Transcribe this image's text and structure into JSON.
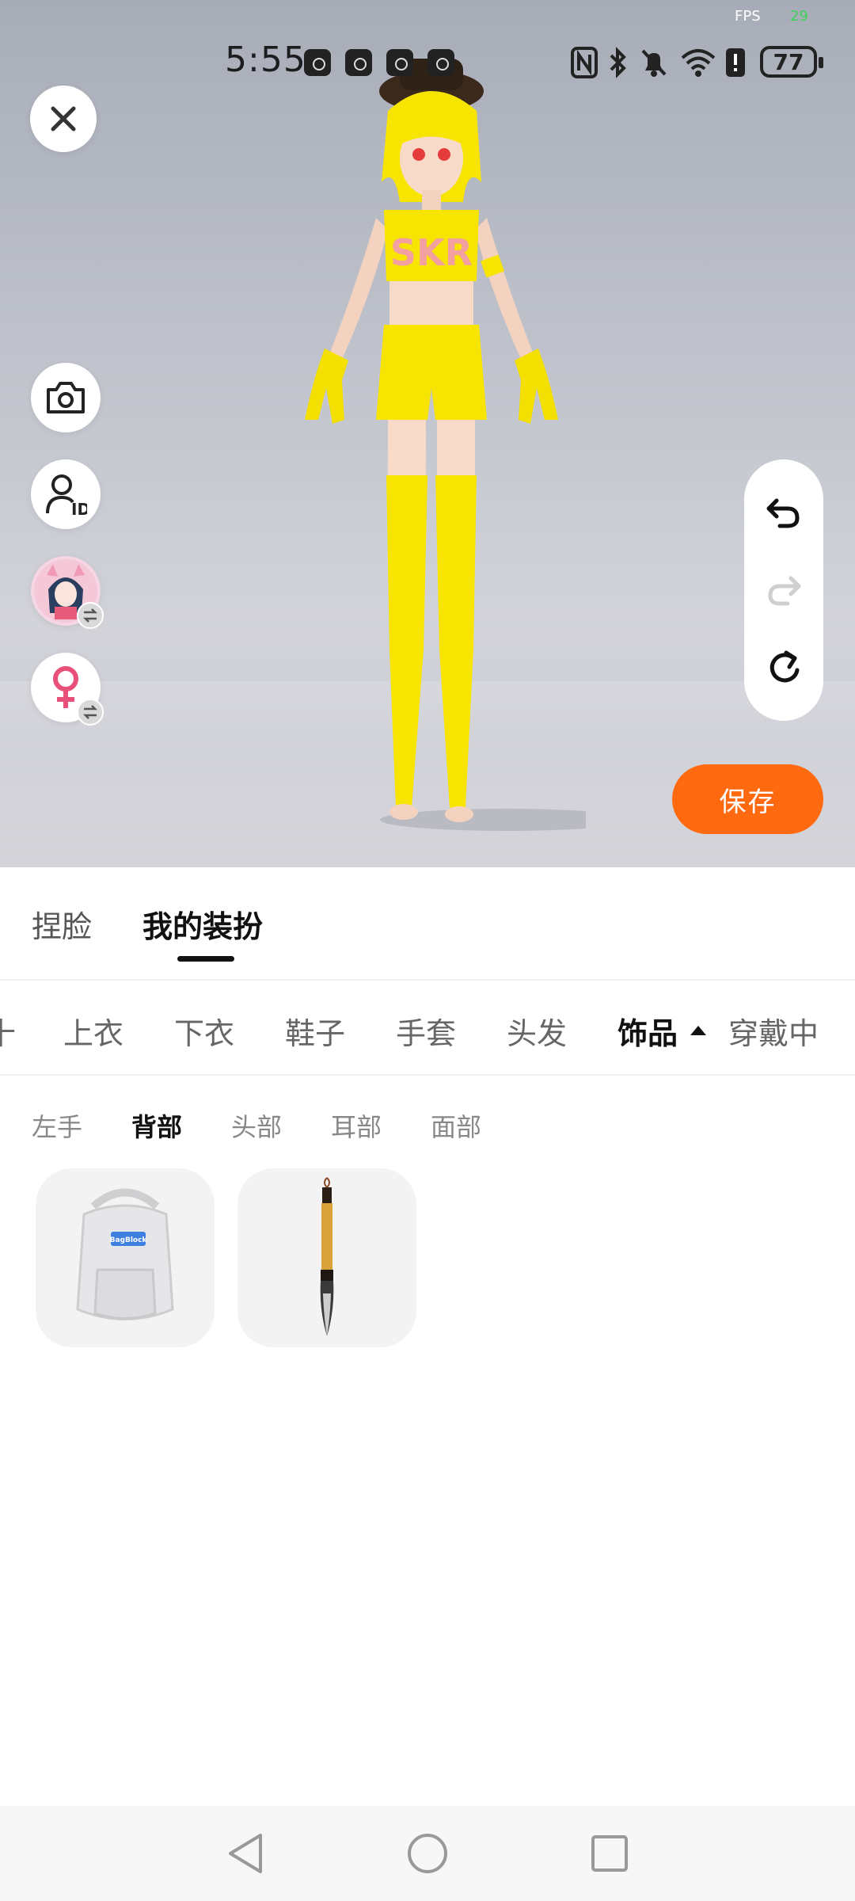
{
  "status_bar": {
    "time": "5:55",
    "fps_label": "FPS",
    "fps_value": "29",
    "battery": "77",
    "icons": [
      "nfc-icon",
      "bluetooth-icon",
      "mute-icon",
      "wifi-icon",
      "sim-alert-icon",
      "battery-icon"
    ]
  },
  "viewport": {
    "close_icon": "close-icon",
    "left_tools": [
      "camera-icon",
      "avatar-id-icon",
      "avatar-thumbnail",
      "female-icon"
    ],
    "history": [
      "undo-icon",
      "redo-icon",
      "reset-icon"
    ],
    "save_label": "保存",
    "accent": "#ff6a10",
    "chest_logo": "SKR"
  },
  "main_tabs": [
    {
      "label": "捏脸",
      "active": false
    },
    {
      "label": "我的装扮",
      "active": true
    }
  ],
  "category_tabs": [
    {
      "label": "十"
    },
    {
      "label": "上衣"
    },
    {
      "label": "下衣"
    },
    {
      "label": "鞋子"
    },
    {
      "label": "手套"
    },
    {
      "label": "头发"
    },
    {
      "label": "饰品",
      "active": true
    },
    {
      "label": "穿戴中"
    }
  ],
  "sub_tabs": [
    {
      "label": "左手"
    },
    {
      "label": "背部",
      "active": true
    },
    {
      "label": "头部"
    },
    {
      "label": "耳部"
    },
    {
      "label": "面部"
    }
  ],
  "items": [
    {
      "name": "backpack",
      "tag": "BagBlock"
    },
    {
      "name": "calligraphy-brush"
    }
  ],
  "nav": [
    "back-icon",
    "home-icon",
    "recents-icon"
  ]
}
